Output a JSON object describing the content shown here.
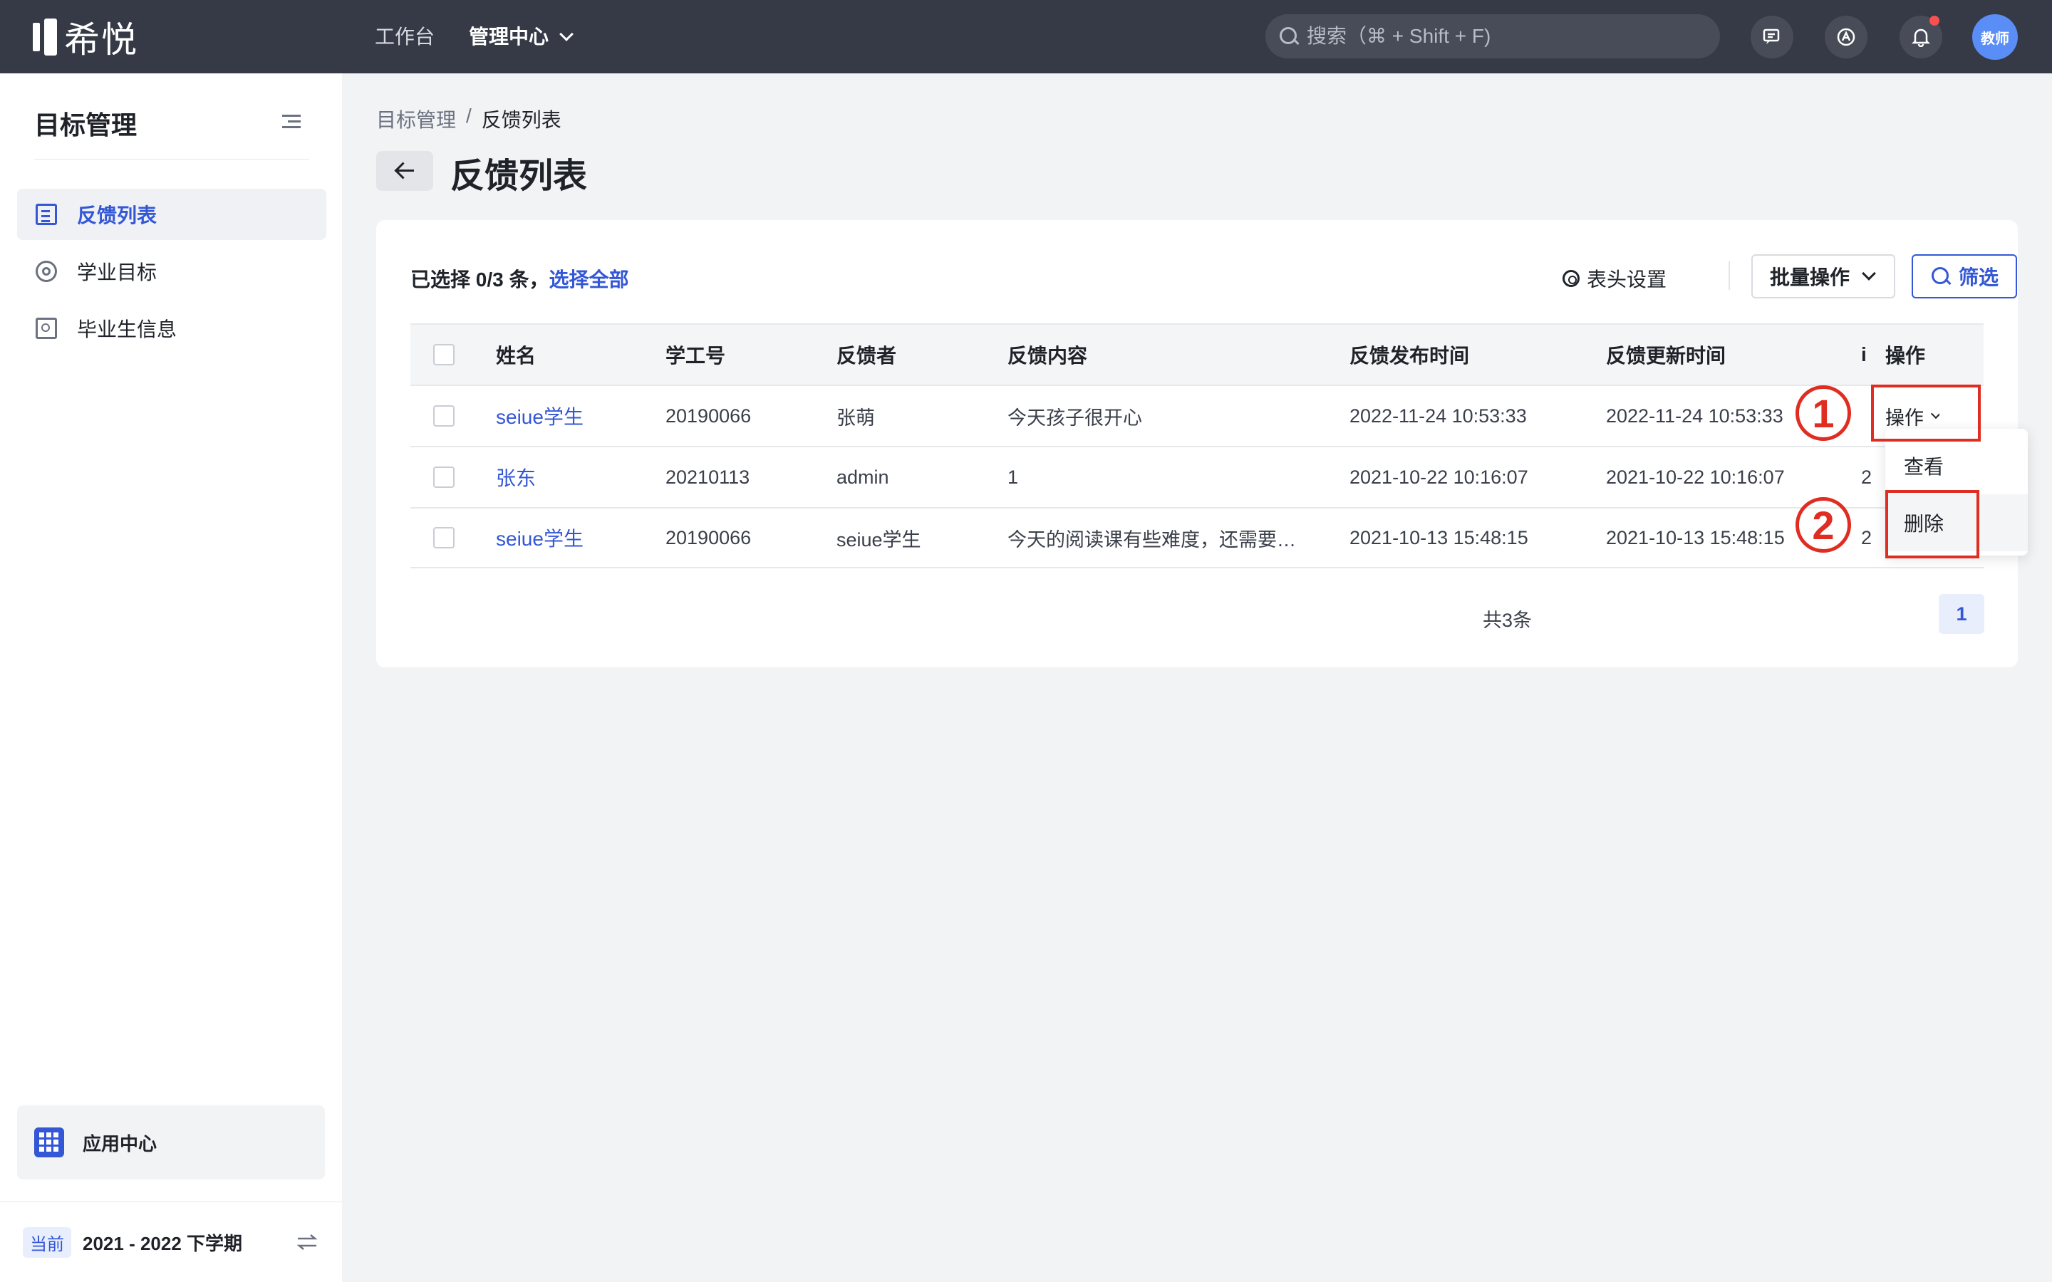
{
  "topbar": {
    "logo_text": "希悦",
    "nav_workbench": "工作台",
    "nav_admin": "管理中心",
    "search_placeholder": "搜索（⌘ + Shift + F)",
    "avatar_label": "教师"
  },
  "sidebar": {
    "title": "目标管理",
    "items": [
      {
        "label": "反馈列表",
        "icon": "document-icon",
        "active": true
      },
      {
        "label": "学业目标",
        "icon": "target-icon",
        "active": false
      },
      {
        "label": "毕业生信息",
        "icon": "id-card-icon",
        "active": false
      }
    ],
    "app_center": "应用中心",
    "term_tag": "当前",
    "term": "2021 - 2022 下学期"
  },
  "main": {
    "breadcrumb": [
      "目标管理",
      "/",
      "反馈列表"
    ],
    "page_title": "反馈列表",
    "selection": {
      "prefix": "已选择 0/3 条，",
      "select_all": "选择全部"
    },
    "header_settings": "表头设置",
    "batch_ops": "批量操作",
    "filter": "筛选",
    "table": {
      "columns": [
        "姓名",
        "学工号",
        "反馈者",
        "反馈内容",
        "反馈发布时间",
        "反馈更新时间",
        "i",
        "操作"
      ],
      "rows": [
        {
          "name": "seiue学生",
          "id": "20190066",
          "feedbacker": "张萌",
          "content": "今天孩子很开心",
          "published": "2022-11-24 10:53:33",
          "updated": "2022-11-24 10:53:33",
          "extra": "",
          "op": "操作"
        },
        {
          "name": "张东",
          "id": "20210113",
          "feedbacker": "admin",
          "content": "1",
          "published": "2021-10-22 10:16:07",
          "updated": "2021-10-22 10:16:07",
          "extra": "2",
          "op": ""
        },
        {
          "name": "seiue学生",
          "id": "20190066",
          "feedbacker": "seiue学生",
          "content": "今天的阅读课有些难度，还需要继续加油",
          "published": "2021-10-13 15:48:15",
          "updated": "2021-10-13 15:48:15",
          "extra": "2",
          "op": ""
        }
      ]
    },
    "total": "共3条",
    "page": "1"
  },
  "dropdown": {
    "view": "查看",
    "delete": "删除"
  },
  "annotations": {
    "step1": "1",
    "step2": "2",
    "color": "#e02d22"
  },
  "colors": {
    "topbar": "#353a46",
    "accent": "#3357d6",
    "background": "#f2f3f5"
  }
}
